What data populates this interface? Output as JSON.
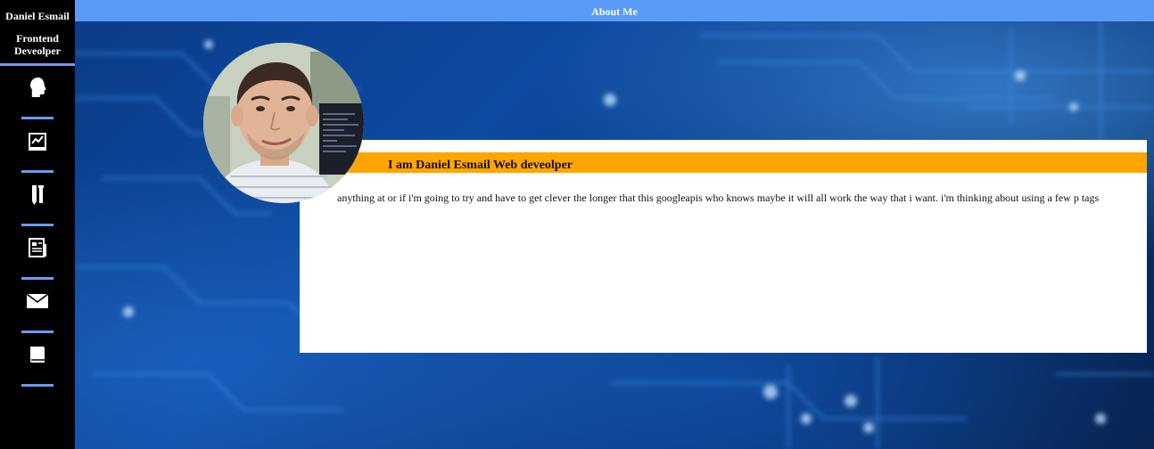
{
  "sidebar": {
    "name": "Daniel Esmail",
    "role": "Frontend Deveolper",
    "items": [
      {
        "icon": "head-icon"
      },
      {
        "icon": "chart-icon"
      },
      {
        "icon": "tools-icon"
      },
      {
        "icon": "newspaper-icon"
      },
      {
        "icon": "mail-icon"
      },
      {
        "icon": "book-icon"
      }
    ]
  },
  "header": {
    "title": "About Me"
  },
  "about": {
    "headline": "I am Daniel Esmail Web deveolper",
    "bio": "anything at or if i'm going to try and have to get clever the longer that this googleapis who knows maybe it will all work the way that i want. i'm thinking about using a few p tags"
  },
  "colors": {
    "sidebar_bg": "#000000",
    "accent_blue": "#5a9bf8",
    "separator": "#6a9cf0",
    "banner": "#ffa500",
    "card": "#ffffff"
  }
}
